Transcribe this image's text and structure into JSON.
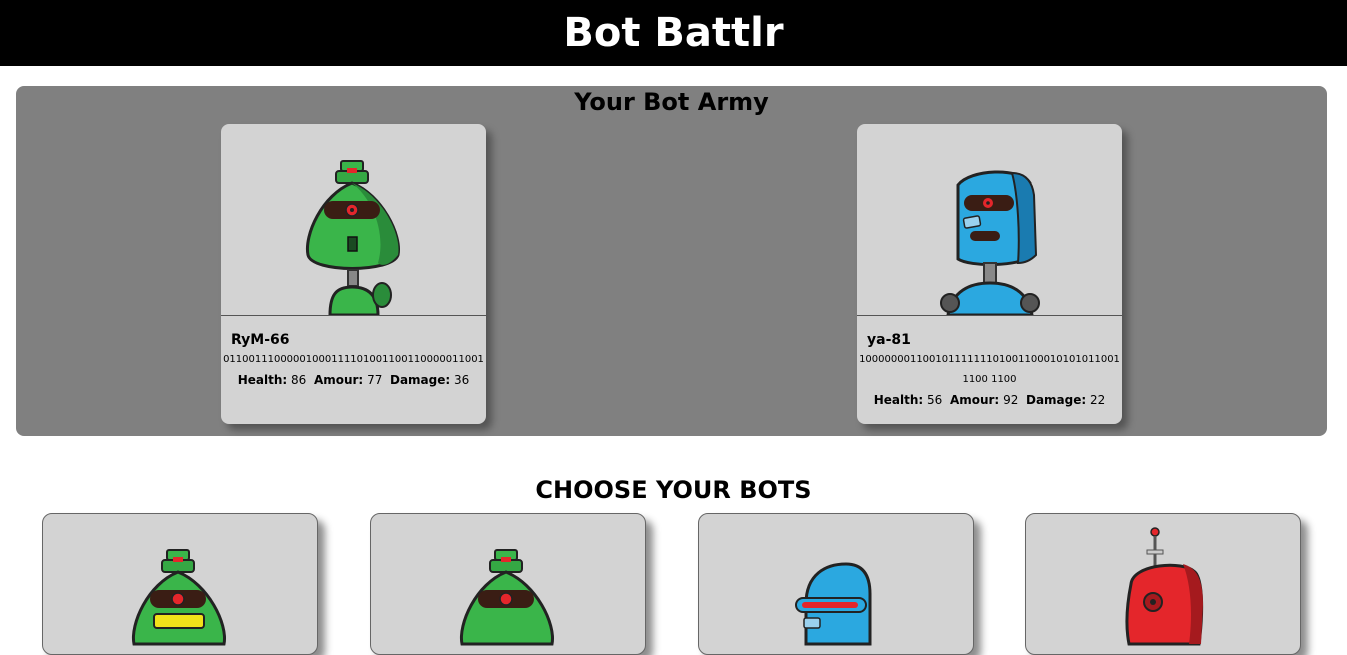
{
  "app": {
    "title": "Bot Battlr"
  },
  "army": {
    "title": "Your Bot Army",
    "bots": [
      {
        "name": "RyM-66",
        "catchphrase": "01100111000001000111101001100110000011001",
        "health_label": "Health:",
        "health": "86",
        "armor_label": "Amour:",
        "armor": "77",
        "damage_label": "Damage:",
        "damage": "36",
        "icon": "green-robot-icon"
      },
      {
        "name": "ya-81",
        "catchphrase": "10000000110010111111101001100010101011001110011 00",
        "catchphrase_display": "100000001100101111111010011000101010110011100 1100",
        "health_label": "Health:",
        "health": "56",
        "armor_label": "Amour:",
        "armor": "92",
        "damage_label": "Damage:",
        "damage": "22",
        "icon": "blue-robot-icon"
      }
    ]
  },
  "collection": {
    "title": "CHOOSE YOUR BOTS",
    "bots": [
      {
        "icon": "green-robot-icon"
      },
      {
        "icon": "green-robot-icon"
      },
      {
        "icon": "blue-robot-icon"
      },
      {
        "icon": "red-robot-icon"
      }
    ]
  },
  "colors": {
    "header_bg": "#000000",
    "army_bg": "#808080",
    "card_bg": "#d3d3d3",
    "green": "#35b34a",
    "blue": "#2ba8e0",
    "red": "#e4262b"
  }
}
